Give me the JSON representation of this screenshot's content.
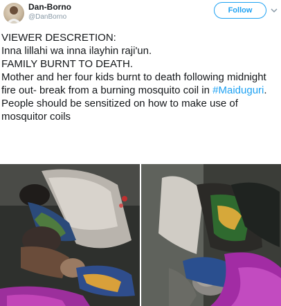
{
  "author": {
    "name": "Dan-Borno",
    "handle": "@DanBorno",
    "avatar_icon": "profile-avatar-icon"
  },
  "header": {
    "follow_label": "Follow",
    "menu_icon": "chevron-down-icon"
  },
  "tweet": {
    "line1": "VIEWER DESCRETION:",
    "line2": "Inna lillahi wa inna ilayhin raji'un.",
    "line3": "FAMILY BURNT TO DEATH.",
    "line4a": "Mother and her four kids burnt to death following midnight fire out- break from a burning mosquito coil in ",
    "hashtag": "#Maiduguri",
    "line4b": ".",
    "line5": "People should be sensitized on how to make use of mosquitor coils"
  },
  "colors": {
    "accent": "#1da1f2",
    "text": "#14171a",
    "muted": "#8899a6"
  }
}
